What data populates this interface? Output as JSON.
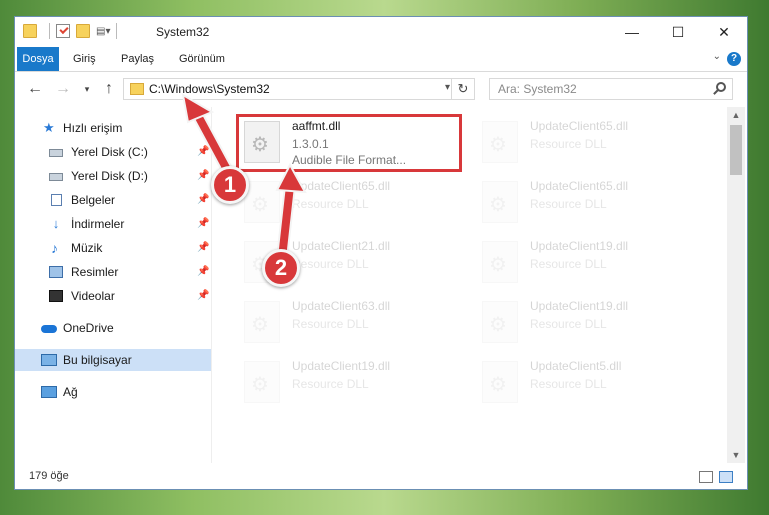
{
  "window": {
    "title": "System32",
    "controls": {
      "minimize": "—",
      "maximize": "☐",
      "close": "✕"
    }
  },
  "ribbon": {
    "tabs": [
      {
        "label": "Dosya",
        "active": true
      },
      {
        "label": "Giriş"
      },
      {
        "label": "Paylaş"
      },
      {
        "label": "Görünüm"
      }
    ],
    "help": "?"
  },
  "nav": {
    "address": "C:\\Windows\\System32",
    "search_placeholder": "Ara: System32"
  },
  "sidebar": {
    "items": [
      {
        "label": "Hızlı erişim",
        "icon": "star-icon",
        "pinned": false
      },
      {
        "label": "Yerel Disk (C:)",
        "icon": "disk-icon",
        "pinned": true
      },
      {
        "label": "Yerel Disk (D:)",
        "icon": "disk-icon",
        "pinned": true
      },
      {
        "label": "Belgeler",
        "icon": "documents-icon",
        "pinned": true
      },
      {
        "label": "İndirmeler",
        "icon": "download-icon",
        "pinned": true
      },
      {
        "label": "Müzik",
        "icon": "music-icon",
        "pinned": true
      },
      {
        "label": "Resimler",
        "icon": "pictures-icon",
        "pinned": true
      },
      {
        "label": "Videolar",
        "icon": "video-icon",
        "pinned": true
      },
      {
        "label": "OneDrive",
        "icon": "cloud-icon",
        "pinned": false
      },
      {
        "label": "Bu bilgisayar",
        "icon": "computer-icon",
        "pinned": false,
        "selected": true
      },
      {
        "label": "Ağ",
        "icon": "network-icon",
        "pinned": false
      }
    ]
  },
  "files": {
    "highlighted": {
      "name": "aaffmt.dll",
      "version": "1.3.0.1",
      "description": "Audible File Format..."
    },
    "items": [
      {
        "name": "UpdateClient65.dll",
        "type": "Resource DLL"
      },
      {
        "name": "UpdateClient65.dll",
        "type": "Resource DLL"
      },
      {
        "name": "UpdateClient65.dll",
        "type": "Resource DLL"
      },
      {
        "name": "UpdateClient21.dll",
        "type": "Resource DLL"
      },
      {
        "name": "UpdateClient19.dll",
        "type": "Resource DLL"
      },
      {
        "name": "UpdateClient63.dll",
        "type": "Resource DLL"
      },
      {
        "name": "UpdateClient19.dll",
        "type": "Resource DLL"
      },
      {
        "name": "UpdateClient19.dll",
        "type": "Resource DLL"
      },
      {
        "name": "UpdateClient5.dll",
        "type": "Resource DLL"
      }
    ]
  },
  "status": {
    "count": "179 öğe"
  },
  "annotations": {
    "step1": "1",
    "step2": "2",
    "color": "#d8383a"
  }
}
